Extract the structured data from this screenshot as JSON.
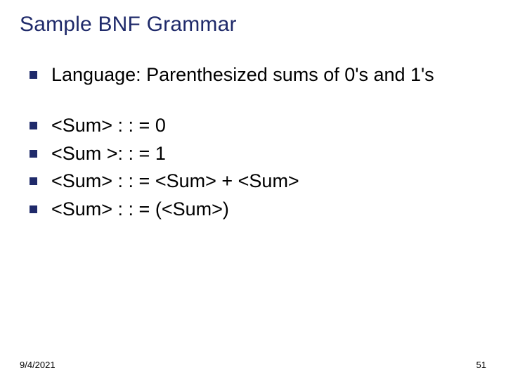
{
  "title": "Sample BNF Grammar",
  "items": [
    "Language: Parenthesized sums of 0's and 1's",
    "<Sum> : : = 0",
    "<Sum >: : = 1",
    "<Sum> : : = <Sum> + <Sum>",
    "<Sum> : : = (<Sum>)"
  ],
  "footer": {
    "date": "9/4/2021",
    "page": "51"
  }
}
